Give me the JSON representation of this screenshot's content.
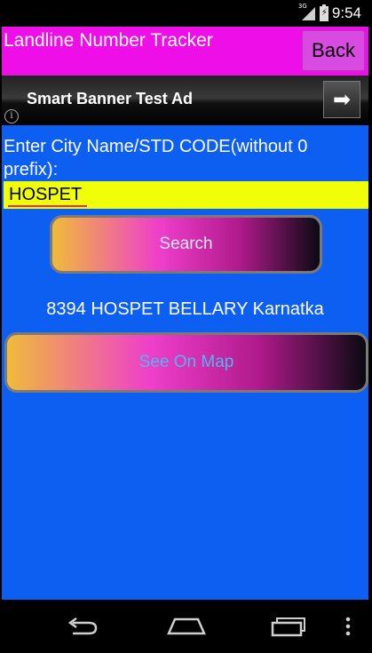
{
  "status_bar": {
    "network": "3G",
    "time": "9:54"
  },
  "header": {
    "title": "Landline Number Tracker",
    "back_label": "Back"
  },
  "ad": {
    "text": "Smart Banner Test Ad",
    "info_glyph": "i",
    "arrow_glyph": "➡"
  },
  "form": {
    "prompt": "Enter City Name/STD CODE(without 0 prefix):",
    "city_value": "HOSPET",
    "search_label": "Search"
  },
  "result": {
    "text": "8394  HOSPET BELLARY Karnatka"
  },
  "map_button": {
    "label": "See On Map"
  },
  "nav": {
    "icons": [
      "back-icon",
      "home-icon",
      "recents-icon",
      "overflow-menu-icon"
    ]
  },
  "colors": {
    "screen_bg": "#0d5ff2",
    "title_bar": "#ee0ee7",
    "input_bg": "#f0ff08"
  }
}
